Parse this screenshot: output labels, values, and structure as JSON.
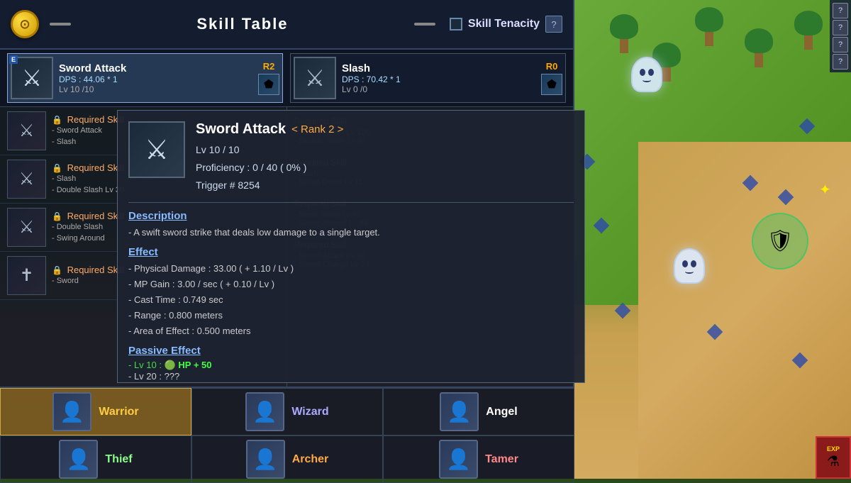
{
  "header": {
    "title": "Skill Table",
    "coin_symbol": "⊙",
    "tenacity_label": "Skill Tenacity",
    "question_label": "?"
  },
  "skill_slots": [
    {
      "name": "Sword Attack",
      "dps": "DPS : 44.06 * 1",
      "level": "Lv 10 /10",
      "rank": "R2",
      "icon": "⚔",
      "badge": "E",
      "active": true
    },
    {
      "name": "Slash",
      "dps": "DPS : 70.42 * 1",
      "level": "Lv 0 /0",
      "rank": "R0",
      "icon": "⚔",
      "active": false
    }
  ],
  "skill_list_left": [
    {
      "locked": true,
      "name": "Required Skill",
      "details": [
        "- Sword Attack",
        "- Slash"
      ],
      "icon": "⚔"
    },
    {
      "locked": true,
      "name": "Required Skill",
      "details": [
        "- Slash",
        "- Double Slash Lv 30"
      ],
      "icon": "⚔"
    },
    {
      "locked": true,
      "name": "Required Skill",
      "details": [
        "- Double Slash",
        "- Swing Around"
      ],
      "icon": "⚔"
    },
    {
      "locked": true,
      "name": "Required Skill",
      "details": [
        "- Sword"
      ],
      "icon": "✝"
    }
  ],
  "skill_list_right": [
    {
      "locked": false,
      "section_title": "Required Skill",
      "details": [
        "- Sword Attack Lv 120",
        "- Double Slash Lv 48"
      ]
    },
    {
      "locked": false,
      "section_title": "Required Skill",
      "details": [
        "- Slash",
        "- Swing Down Lv 11"
      ]
    },
    {
      "locked": false,
      "section_title": "Required Skill",
      "details": [
        "- Sonic Slash Lv 90",
        "- Swing Around Lv 48"
      ]
    },
    {
      "locked": false,
      "section_title": "Required Skill",
      "details": [
        "- Sword Attack Lv 90",
        "- Shield Charge Lv 24"
      ]
    }
  ],
  "popup": {
    "skill_name": "Sword Attack",
    "rank": "< Rank 2 >",
    "level": "Lv 10 / 10",
    "proficiency": "Proficiency : 0 / 40 ( 0% )",
    "trigger": "Trigger # 8254",
    "description_title": "Description",
    "description_text": "- A swift sword strike that deals low damage to a single target.",
    "effect_title": "Effect",
    "effect_lines": [
      "- Physical Damage : 33.00 ( + 1.10 / Lv )",
      "- MP Gain : 3.00 / sec  ( + 0.10 / Lv )",
      "- Cast Time : 0.749 sec",
      "- Range : 0.800 meters",
      "- Area of Effect : 0.500 meters"
    ],
    "passive_title": "Passive Effect",
    "passive_lines": [
      "- Lv 10 :  HP + 50",
      "- Lv 20 : ???"
    ]
  },
  "class_tabs": [
    {
      "name": "Warrior",
      "icon": "⚔",
      "active": true
    },
    {
      "name": "Wizard",
      "icon": "🔮",
      "active": false
    },
    {
      "name": "Angel",
      "icon": "👼",
      "active": false
    },
    {
      "name": "Thief",
      "icon": "🗡",
      "active": false
    },
    {
      "name": "Archer",
      "icon": "🏹",
      "active": false
    },
    {
      "name": "Tamer",
      "icon": "🐾",
      "active": false
    }
  ],
  "right_buttons": [
    "?",
    "?",
    "?",
    "?"
  ],
  "icons": {
    "coin": "⊙",
    "sword": "⚔",
    "cross": "✝",
    "lock": "🔒",
    "shield": "🛡",
    "ghost": "👻"
  }
}
